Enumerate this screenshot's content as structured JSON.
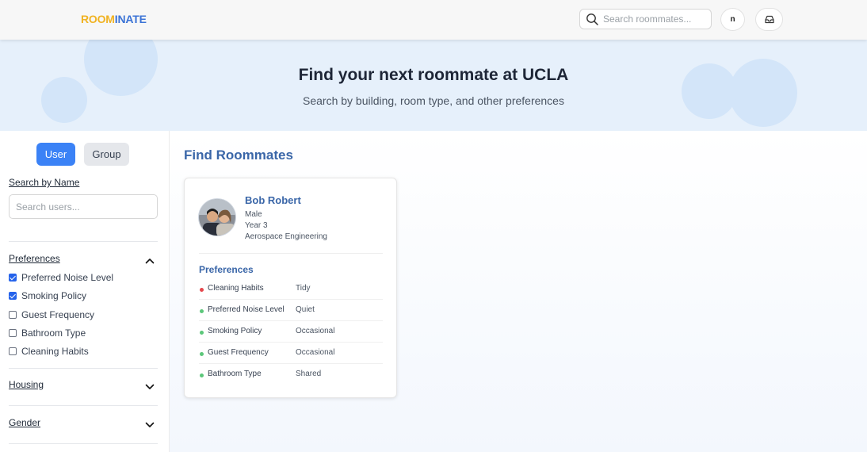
{
  "header": {
    "logo_part1": "ROOM",
    "logo_part2": "INATE",
    "search_placeholder": "Search roommates...",
    "avatar_initial": "n"
  },
  "hero": {
    "title": "Find your next roommate at UCLA",
    "subtitle": "Search by building, room type, and other preferences"
  },
  "sidebar": {
    "toggle_user": "User",
    "toggle_group": "Group",
    "search_label": "Search by Name",
    "search_placeholder": "Search users...",
    "preferences_label": "Preferences",
    "preferences": [
      {
        "label": "Preferred Noise Level",
        "checked": true
      },
      {
        "label": "Smoking Policy",
        "checked": true
      },
      {
        "label": "Guest Frequency",
        "checked": false
      },
      {
        "label": "Bathroom Type",
        "checked": false
      },
      {
        "label": "Cleaning Habits",
        "checked": false
      }
    ],
    "housing_label": "Housing",
    "gender_label": "Gender"
  },
  "main": {
    "title": "Find Roommates",
    "card": {
      "name": "Bob Robert",
      "gender": "Male",
      "year": "Year 3",
      "major": "Aerospace Engineering",
      "preferences_title": "Preferences",
      "prefs": [
        {
          "key": "Cleaning Habits",
          "value": "Tidy",
          "dot": "#e5484d"
        },
        {
          "key": "Preferred Noise Level",
          "value": "Quiet",
          "dot": "#5cc77a"
        },
        {
          "key": "Smoking Policy",
          "value": "Occasional",
          "dot": "#5cc77a"
        },
        {
          "key": "Guest Frequency",
          "value": "Occasional",
          "dot": "#5cc77a"
        },
        {
          "key": "Bathroom Type",
          "value": "Shared",
          "dot": "#5cc77a"
        }
      ]
    }
  },
  "colors": {
    "accent": "#3b82f6",
    "title_blue": "#3a66a8",
    "hero_bg": "#e6f0fb",
    "logo_yellow": "#f0b323",
    "logo_blue": "#3b73d6"
  },
  "icons": [
    "search-icon",
    "inbox-icon",
    "chevron-up-icon",
    "chevron-down-icon"
  ]
}
